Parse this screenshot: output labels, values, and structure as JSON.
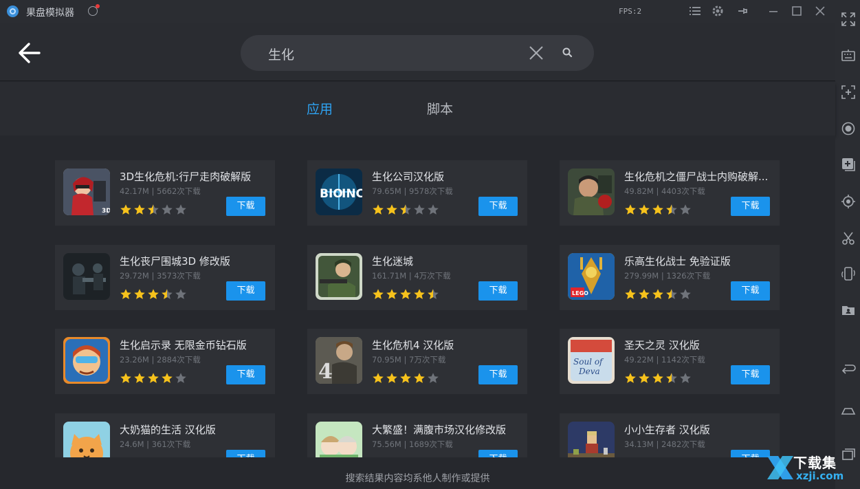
{
  "window": {
    "title": "果盘模拟器",
    "fps": "FPS:2"
  },
  "search": {
    "query": "生化"
  },
  "tabs": [
    {
      "label": "应用",
      "active": true
    },
    {
      "label": "脚本",
      "active": false
    }
  ],
  "apps": [
    {
      "name": "3D生化危机:行尸走肉破解版",
      "size": "42.17M",
      "downloads": "5662次下载",
      "meta": "42.17M | 5662次下载",
      "rating": 2.5,
      "button": "下载",
      "icon": "zombie-girl-icon"
    },
    {
      "name": "生化公司汉化版",
      "size": "79.65M",
      "downloads": "9578次下载",
      "meta": "79.65M | 9578次下载",
      "rating": 2.5,
      "button": "下载",
      "icon": "bio-inc-icon"
    },
    {
      "name": "生化危机之僵尸战士内购破解...",
      "size": "49.82M",
      "downloads": "4403次下载",
      "meta": "49.82M | 4403次下载",
      "rating": 3.5,
      "button": "下载",
      "icon": "zombie-soldier-icon"
    },
    {
      "name": "生化丧尸围城3D 修改版",
      "size": "29.72M",
      "downloads": "3573次下载",
      "meta": "29.72M | 3573次下载",
      "rating": 3.5,
      "button": "下载",
      "icon": "dark-soldier-icon"
    },
    {
      "name": "生化迷城",
      "size": "161.71M",
      "downloads": "4万次下载",
      "meta": "161.71M | 4万次下载",
      "rating": 4.5,
      "button": "下载",
      "icon": "green-soldier-icon"
    },
    {
      "name": "乐高生化战士 免验证版",
      "size": "279.99M",
      "downloads": "1326次下载",
      "meta": "279.99M | 1326次下载",
      "rating": 3.5,
      "button": "下载",
      "icon": "lego-bionicle-icon"
    },
    {
      "name": "生化启示录 无限金币钻石版",
      "size": "23.26M",
      "downloads": "2884次下载",
      "meta": "23.26M | 2884次下载",
      "rating": 4,
      "button": "下载",
      "icon": "cartoon-hero-icon"
    },
    {
      "name": "生化危机4 汉化版",
      "size": "70.95M",
      "downloads": "7万次下载",
      "meta": "70.95M | 7万次下载",
      "rating": 4,
      "button": "下载",
      "icon": "resident-evil-4-icon"
    },
    {
      "name": "圣天之灵  汉化版",
      "size": "49.22M",
      "downloads": "1142次下载",
      "meta": "49.22M | 1142次下载",
      "rating": 3.5,
      "button": "下载",
      "icon": "soul-of-deva-icon"
    },
    {
      "name": "大奶猫的生活 汉化版",
      "size": "24.6M",
      "downloads": "361次下载",
      "meta": "24.6M | 361次下载",
      "rating": 0,
      "button": "下载",
      "icon": "cat-icon"
    },
    {
      "name": "大繁盛！满腹市场汉化修改版",
      "size": "75.56M",
      "downloads": "1689次下载",
      "meta": "75.56M | 1689次下载",
      "rating": 0,
      "button": "下载",
      "icon": "anime-girls-icon"
    },
    {
      "name": "小小生存者  汉化版",
      "size": "34.13M",
      "downloads": "2482次下载",
      "meta": "34.13M | 2482次下载",
      "rating": 0,
      "button": "下载",
      "icon": "pixel-survivor-icon"
    }
  ],
  "footer": {
    "note": "搜索结果内容均系他人制作或提供"
  },
  "watermark": {
    "text": "下载集",
    "url": "xzji.com"
  },
  "colors": {
    "accent": "#1a93ec",
    "tab_active": "#2ea3f2",
    "star_filled": "#f6c21c",
    "star_empty": "#6f737a",
    "background": "#26282d",
    "card": "#2e3035"
  }
}
